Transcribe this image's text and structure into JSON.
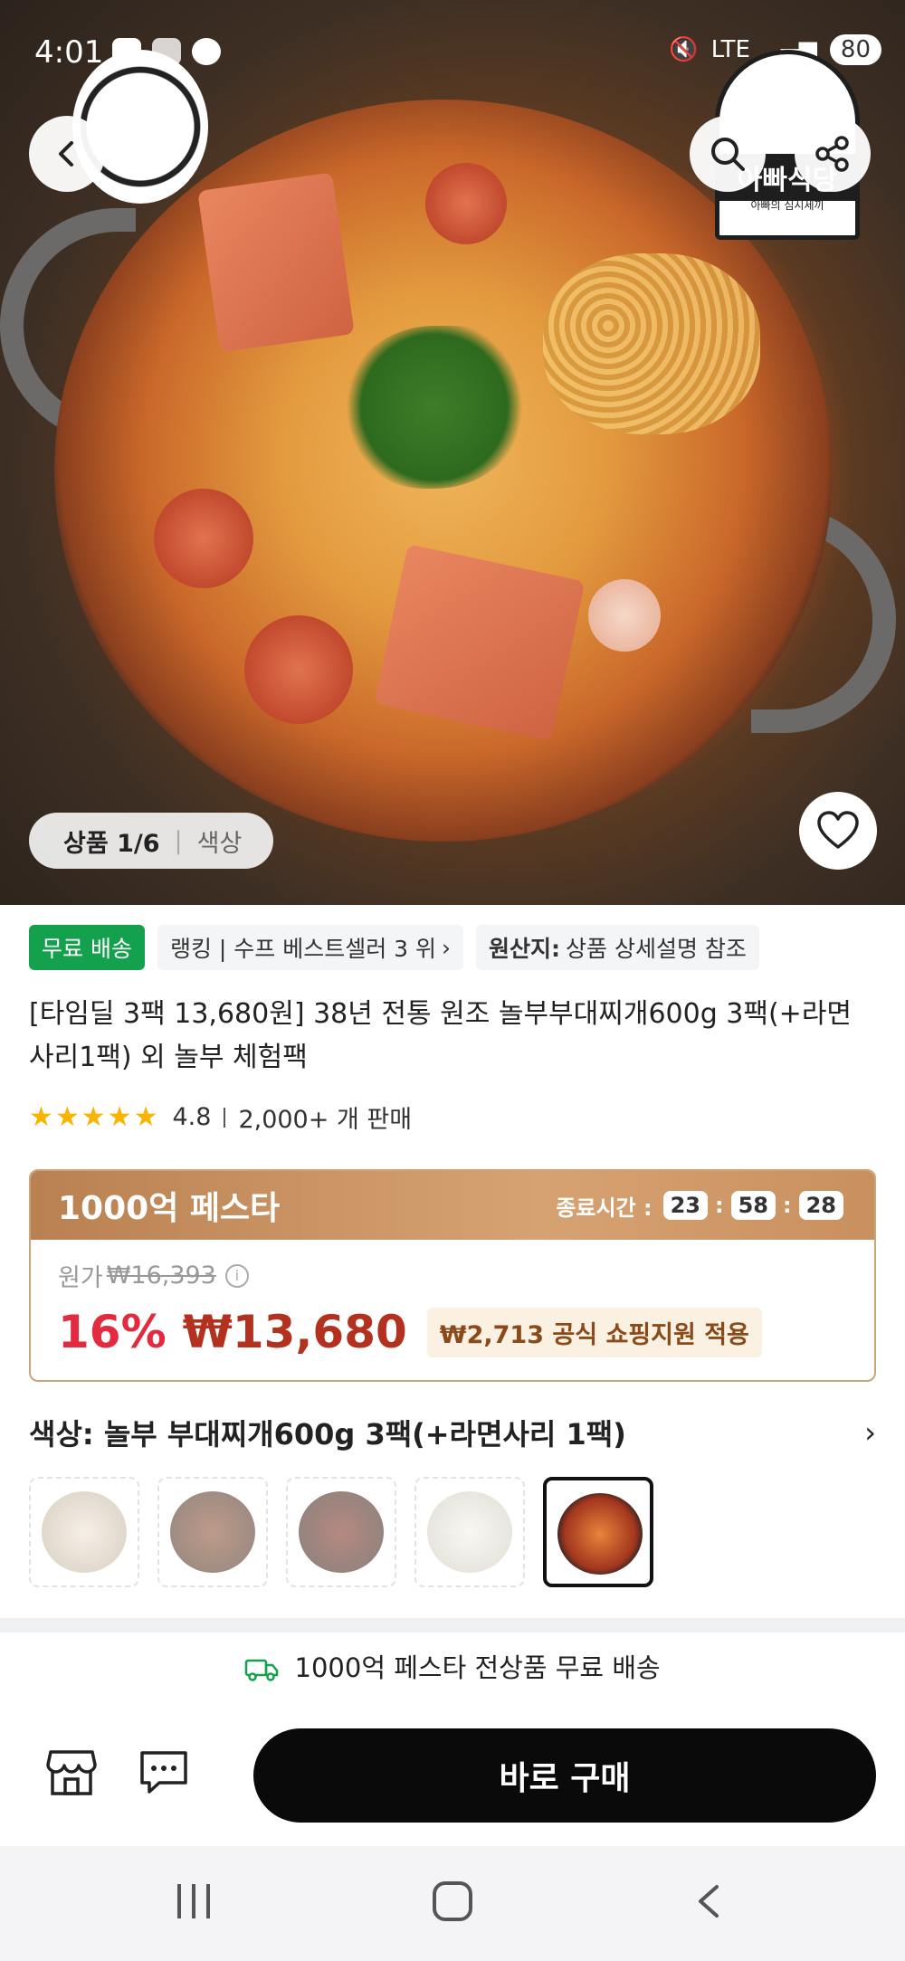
{
  "statusbar": {
    "time": "4:01",
    "network": "LTE",
    "battery": "80"
  },
  "gallery": {
    "counter_label": "상품 1/6",
    "option_label": "색상"
  },
  "brand_logo": {
    "name": "아빠식당",
    "subtitle": "아빠의 심시세끼"
  },
  "tags": {
    "free_shipping": "무료 배송",
    "ranking": "랭킹 | 수프 베스트셀러 3 위",
    "origin_label": "원산지:",
    "origin_value": "상품 상세설명 참조"
  },
  "product": {
    "title": "[타임딜 3팩 13,680원] 38년 전통 원조 놀부부대찌개600g 3팩(+라면사리1팩) 외 놀부 체험팩",
    "stars": "★★★★★",
    "rating": "4.8",
    "sold": "2,000+ 개 판매"
  },
  "promo": {
    "title": "1000억 페스타",
    "end_label": "종료시간 :",
    "hours": "23",
    "minutes": "58",
    "seconds": "28",
    "original_label": "원가",
    "original_price": "₩16,393",
    "discount": "16%",
    "price": "₩13,680",
    "support": "₩2,713 공식 쇼핑지원 적용"
  },
  "option": {
    "label": "색상: 놀부 부대찌개600g 3팩(+라면사리 1팩)",
    "selected_index": 4
  },
  "bottom": {
    "free_shipping_notice": "1000억 페스타 전상품 무료 배송",
    "buy_label": "바로 구매"
  },
  "colors": {
    "accent_green": "#14a14d",
    "discount_red": "#e22b3f",
    "price_red": "#b3311f",
    "promo_brown": "#c8956a",
    "buy_black": "#0a0a0a"
  },
  "icons": [
    "back-icon",
    "search-icon",
    "share-icon",
    "heart-icon",
    "info-icon",
    "chevron-right-icon",
    "truck-icon",
    "store-icon",
    "chat-icon",
    "nav-menu-icon",
    "nav-home-icon",
    "nav-back-icon"
  ]
}
